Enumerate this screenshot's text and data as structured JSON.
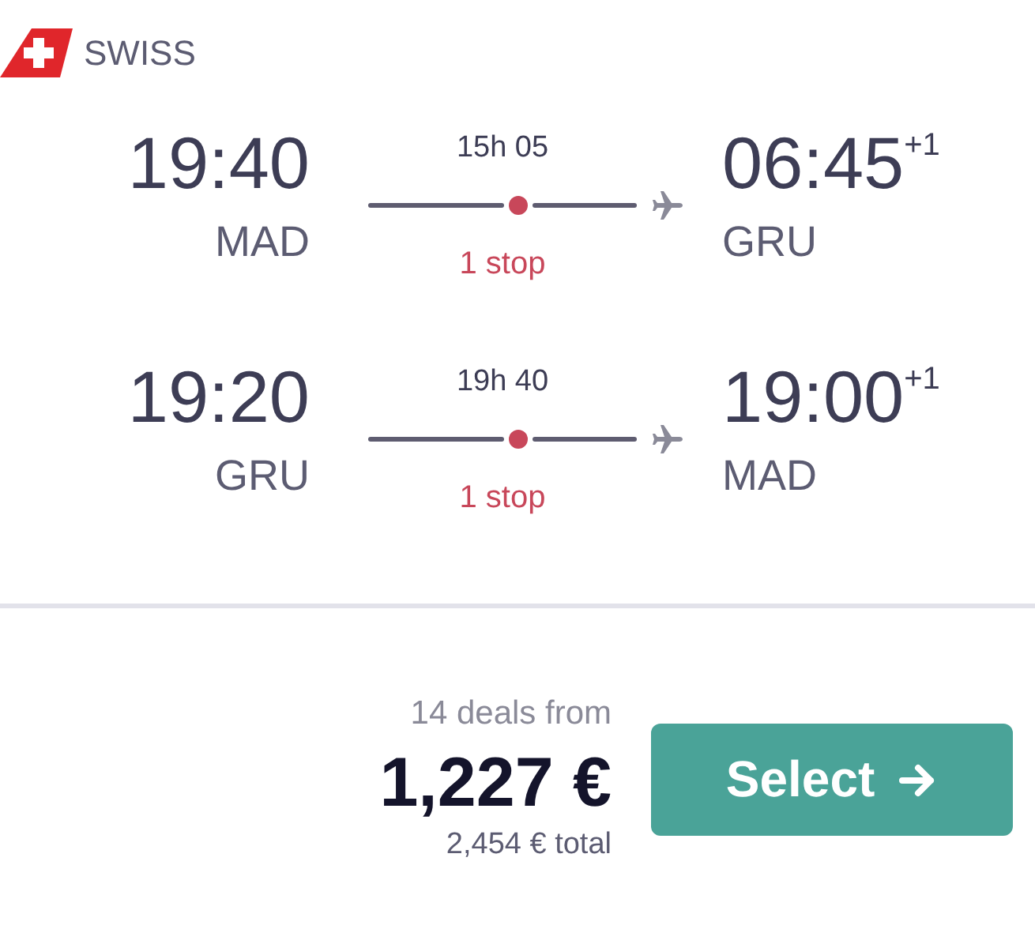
{
  "airline": {
    "name": "SWISS"
  },
  "legs": [
    {
      "departure_time": "19:40",
      "departure_airport": "MAD",
      "duration": "15h 05",
      "stops": "1 stop",
      "arrival_time": "06:45",
      "day_offset": "+1",
      "arrival_airport": "GRU"
    },
    {
      "departure_time": "19:20",
      "departure_airport": "GRU",
      "duration": "19h 40",
      "stops": "1 stop",
      "arrival_time": "19:00",
      "day_offset": "+1",
      "arrival_airport": "MAD"
    }
  ],
  "price": {
    "deals": "14 deals from",
    "amount": "1,227 €",
    "total": "2,454 € total"
  },
  "button": {
    "label": "Select"
  }
}
